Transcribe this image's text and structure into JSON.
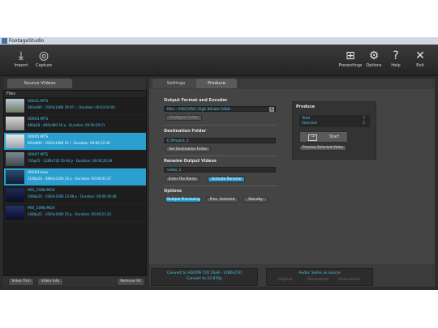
{
  "window": {
    "title": "FootageStudio"
  },
  "toolbar": {
    "left": [
      {
        "label": "Import",
        "icon": "import-icon"
      },
      {
        "label": "Capture",
        "icon": "capture-icon"
      }
    ],
    "right": [
      {
        "label": "Presentings",
        "icon": "grid-icon"
      },
      {
        "label": "Options",
        "icon": "gear-icon"
      },
      {
        "label": "Help",
        "icon": "help-icon"
      },
      {
        "label": "Exit",
        "icon": "close-icon"
      }
    ]
  },
  "left_panel": {
    "tab": "Source Videos",
    "files_label": "Files",
    "files": [
      {
        "name": "00041.MTS",
        "meta": "360x480 - 1920x1080 29.97 i  -  Duration: 00:03:03:04",
        "selected": false
      },
      {
        "name": "00043.MTS",
        "meta": "480p28 - 840x480 30 p  -  Duration: 00:00:29:21",
        "selected": false
      },
      {
        "name": "00005.MTS",
        "meta": "920x800 - 1920x1080 25 i  -  Duration: 00:00:12:26",
        "selected": true
      },
      {
        "name": "00007.MTS",
        "meta": "720p45 - 1280x720 59.94 p  -  Duration: 00:00:20:29",
        "selected": false
      },
      {
        "name": "00264.mov",
        "meta": "2160p24 - 3840x2160 24 p  -  Duration: 00:00:02:37",
        "selected": true
      },
      {
        "name": "MVI_1088.MOV",
        "meta": "1080p24 - 1920x1080 23.98 p  -  Duration: 00:00:16:48",
        "selected": false
      },
      {
        "name": "MVI_1098.MOV",
        "meta": "1080p25 - 1920x1080 25 p  -  Duration: 00:00:21:22",
        "selected": false
      }
    ],
    "buttons": {
      "video_trim": "Video Trim",
      "video_info": "Video Info",
      "remove_all": "Remove All"
    }
  },
  "right_panel": {
    "tabs": {
      "settings": "Settings",
      "produce": "Produce"
    },
    "output": {
      "heading": "Output Format and Encoder",
      "format_value": "Mov - XAVC/AVC High Bitrate 10bit",
      "configure_button": "Configure Codec"
    },
    "destination": {
      "heading": "Destination Folder",
      "path_value": "C:\\Project_1",
      "set_button": "Set Destination Folder"
    },
    "rename": {
      "heading": "Rename Output Videos",
      "name_value": "video_1",
      "enter_button": "Enter File Name",
      "activate_button": "Activate Rename"
    },
    "options": {
      "heading": "Options",
      "multiple": "Multiple Processing",
      "proc_selected": "Proc. Selected",
      "standby": "Standby"
    },
    "produce_box": {
      "title": "Produce",
      "total_label": "Total",
      "total_value": "7",
      "selected_label": "Selected",
      "selected_value": "2",
      "start_button": "Start",
      "preview_button": "Preview Selected Video"
    },
    "footer": {
      "convert_line1": "Convert to HD/ION 720 16x9 - 1280x720",
      "convert_line2": "Convert to 23.976p",
      "audio_line1": "Audio: Same as source",
      "audio_opts": [
        "Original",
        "Stereo/pcm",
        "Downmixed"
      ]
    }
  },
  "colors": {
    "accent": "#2a9fd0",
    "text_accent": "#4fc6f2",
    "background": "#2c2c2c"
  }
}
